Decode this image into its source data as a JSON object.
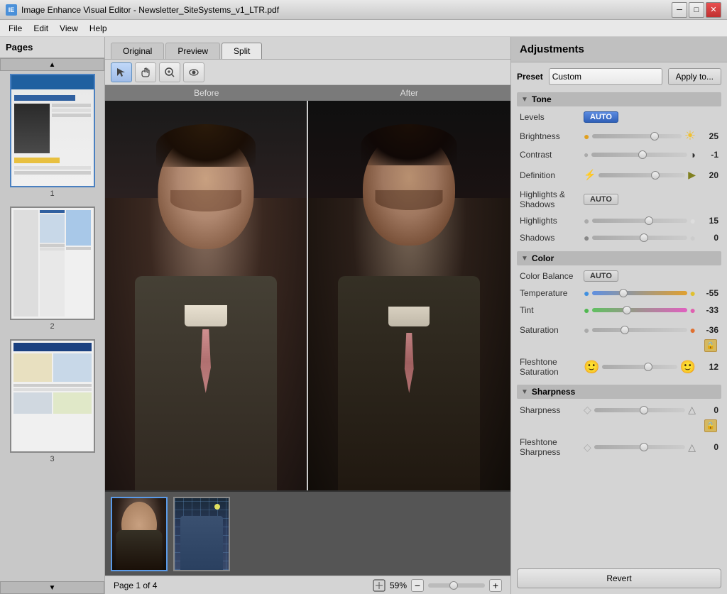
{
  "window": {
    "title": "Image Enhance Visual Editor - Newsletter_SiteSystems_v1_LTR.pdf",
    "icon_label": "IE"
  },
  "menu": {
    "items": [
      "File",
      "Edit",
      "View",
      "Help"
    ]
  },
  "view_tabs": {
    "tabs": [
      "Original",
      "Preview",
      "Split"
    ],
    "active": "Split"
  },
  "tools": {
    "select_label": "▲",
    "pan_label": "✋",
    "zoom_label": "🔍",
    "eye_label": "👁"
  },
  "image_area": {
    "before_label": "Before",
    "after_label": "After"
  },
  "pages": {
    "header": "Pages",
    "items": [
      {
        "num": "1"
      },
      {
        "num": "2"
      },
      {
        "num": "3"
      }
    ]
  },
  "adjustments": {
    "header": "Adjustments",
    "preset_label": "Preset",
    "preset_value": "Custom",
    "apply_to_label": "Apply to...",
    "tone_section": "Tone",
    "levels_label": "Levels",
    "auto_label": "AUTO",
    "brightness_label": "Brightness",
    "brightness_value": "25",
    "contrast_label": "Contrast",
    "contrast_value": "-1",
    "definition_label": "Definition",
    "definition_value": "20",
    "highlights_shadows_label": "Highlights & Shadows",
    "highlights_label": "Highlights",
    "highlights_value": "15",
    "shadows_label": "Shadows",
    "shadows_value": "0",
    "color_section": "Color",
    "color_balance_label": "Color Balance",
    "temperature_label": "Temperature",
    "temperature_value": "-55",
    "tint_label": "Tint",
    "tint_value": "-33",
    "saturation_label": "Saturation",
    "saturation_value": "-36",
    "fleshtone_sat_label": "Fleshtone\nSaturation",
    "fleshtone_sat_value": "12",
    "sharpness_section": "Sharpness",
    "sharpness_label": "Sharpness",
    "sharpness_value": "0",
    "fleshtone_sharp_label": "Fleshtone\nSharpness",
    "fleshtone_sharp_value": "0",
    "revert_label": "Revert"
  },
  "status": {
    "page_info": "Page 1 of 4",
    "zoom_level": "59%"
  }
}
